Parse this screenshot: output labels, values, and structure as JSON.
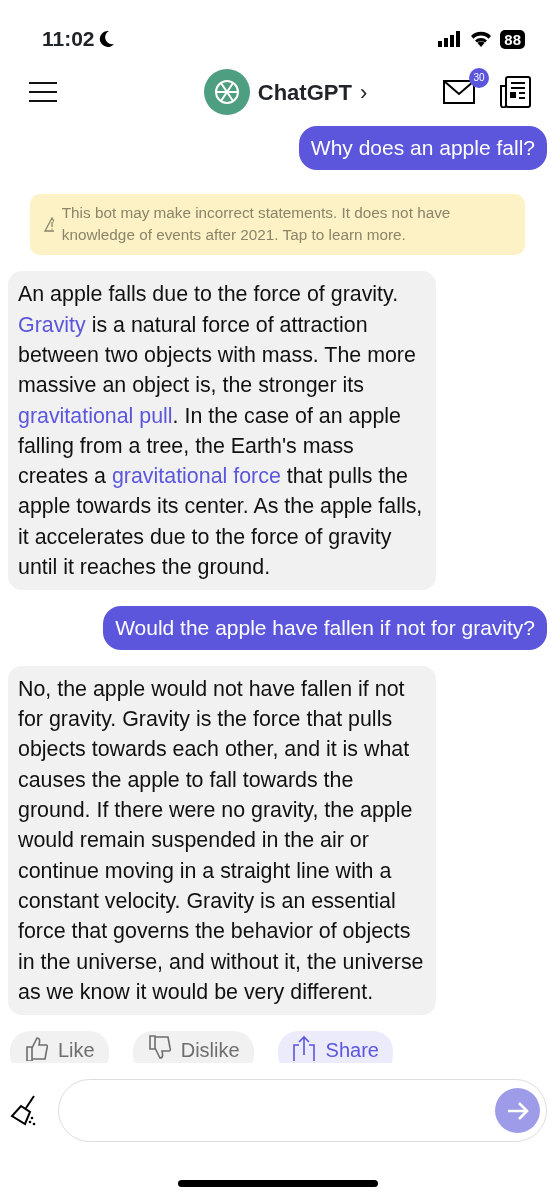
{
  "status_bar": {
    "time": "11:02",
    "battery": "88"
  },
  "header": {
    "title": "ChatGPT",
    "chevron": "›",
    "mail_badge": "30"
  },
  "messages": [
    {
      "kind": "user",
      "text": "Why does an apple fall?"
    },
    {
      "kind": "notice",
      "text": "This bot may make incorrect statements. It does not have knowledge of events after 2021.  Tap to learn more."
    },
    {
      "kind": "bot",
      "segments": [
        {
          "text": "An apple falls due to the force of gravity. ",
          "link": false
        },
        {
          "text": "Gravity",
          "link": true
        },
        {
          "text": " is a natural force of attraction between two objects with mass. The more massive an object is, the stronger its ",
          "link": false
        },
        {
          "text": "gravitational pull",
          "link": true
        },
        {
          "text": ". In the case of an apple falling from a tree, the Earth's mass creates a ",
          "link": false
        },
        {
          "text": "gravitational force",
          "link": true
        },
        {
          "text": " that pulls the apple towards its center. As the apple falls, it accelerates due to the force of gravity until it reaches the ground.",
          "link": false
        }
      ]
    },
    {
      "kind": "user",
      "text": "Would the apple have fallen if not for gravity?"
    },
    {
      "kind": "bot",
      "segments": [
        {
          "text": "No, the apple would not have fallen if not for gravity. Gravity is the force that pulls objects towards each other, and it is what causes the apple to fall towards the ground. If there were no gravity, the apple would remain suspended in the air or continue moving in a straight line with a constant velocity. Gravity is an essential force that governs the behavior of objects in the universe, and without it, the universe as we know it would be very different.",
          "link": false
        }
      ]
    }
  ],
  "actions": [
    {
      "kind": "like",
      "label": "Like"
    },
    {
      "kind": "dislike",
      "label": "Dislike"
    },
    {
      "kind": "share",
      "label": "Share"
    }
  ]
}
